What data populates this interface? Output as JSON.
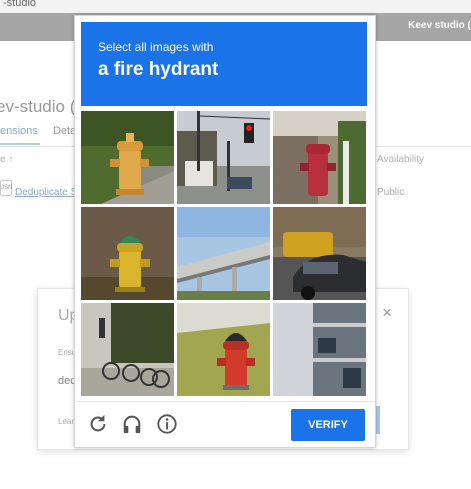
{
  "background_app": {
    "breadcrumb": "-studio",
    "header_user": "Keev studio (p",
    "page_title": "ev-studio (Ke",
    "tabs": [
      {
        "label": "ensions",
        "active": true
      },
      {
        "label": "Deta",
        "active": false
      }
    ],
    "table": {
      "name_header": "e ↑",
      "availability_header": "Availability",
      "row": {
        "icon_text": "JSN",
        "name": "Deduplicate S",
        "availability": "Public"
      }
    },
    "dialog": {
      "title": "Up",
      "close_symbol": "×",
      "field_label": "Ensu",
      "field_value": "dec",
      "learn_link": "Lear"
    }
  },
  "captcha": {
    "instruction": "Select all images with",
    "target": "a fire hydrant",
    "verify_label": "VERIFY",
    "footer_icons": [
      "reload-icon",
      "audio-headphones-icon",
      "info-icon"
    ],
    "accent_color": "#1a73e8",
    "tiles": [
      {
        "id": 1,
        "content": "yellow hydrant on grass"
      },
      {
        "id": 2,
        "content": "street with traffic light"
      },
      {
        "id": 3,
        "content": "red hydrant near wall"
      },
      {
        "id": 4,
        "content": "yellow hydrant with green cap"
      },
      {
        "id": 5,
        "content": "highway overpass"
      },
      {
        "id": 6,
        "content": "parked cars"
      },
      {
        "id": 7,
        "content": "bicycles"
      },
      {
        "id": 8,
        "content": "red hydrant on grass"
      },
      {
        "id": 9,
        "content": "building balconies"
      }
    ]
  }
}
